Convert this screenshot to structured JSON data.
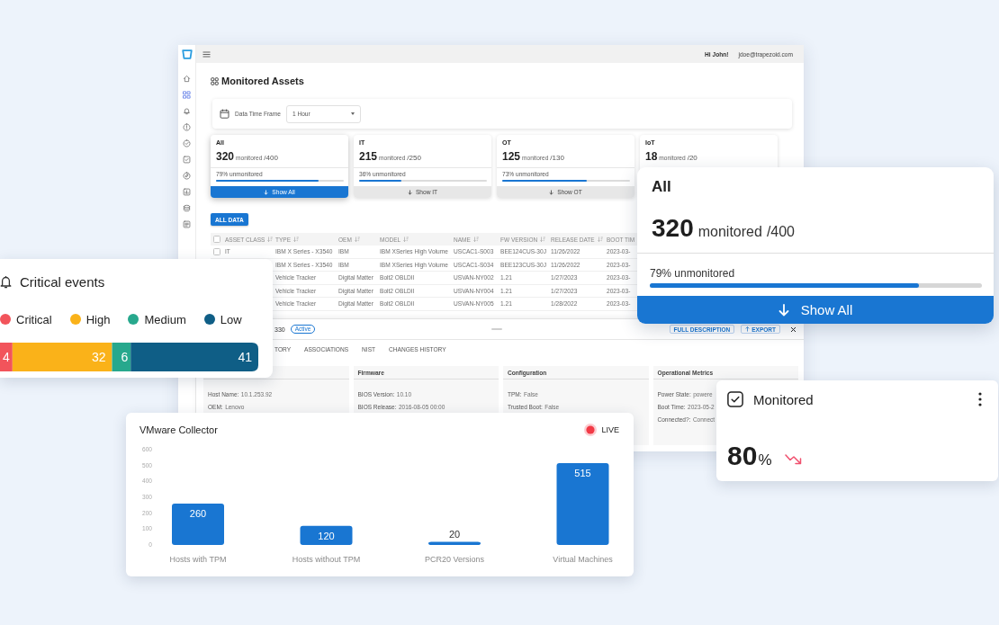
{
  "app": {
    "sidebar": {
      "items": [
        {
          "selected": false
        },
        {
          "selected": true
        },
        {
          "selected": false
        },
        {
          "selected": false
        },
        {
          "selected": false
        },
        {
          "selected": false
        },
        {
          "selected": false
        },
        {
          "selected": false
        },
        {
          "selected": false
        },
        {
          "selected": false
        }
      ]
    },
    "header": {
      "greeting": "Hi John!",
      "email": "jdoe@trapezoid.com"
    },
    "page_title": "Monitored Assets",
    "filter": {
      "label": "Data Time Frame",
      "value": "1 Hour"
    },
    "summary_cards": [
      {
        "title": "All",
        "count": "320",
        "unit": "monitored",
        "total": "/400",
        "unmonitored": "79% unmonitored",
        "level": 0.8,
        "button": "Show All",
        "selected": true
      },
      {
        "title": "IT",
        "count": "215",
        "unit": "monitored",
        "total": "/250",
        "unmonitored": "36% unmonitored",
        "level": 0.33,
        "button": "Show IT",
        "selected": false
      },
      {
        "title": "OT",
        "count": "125",
        "unit": "monitored",
        "total": "/130",
        "unmonitored": "73% unmonitored",
        "level": 0.66,
        "button": "Show OT",
        "selected": false
      },
      {
        "title": "IoT",
        "count": "18",
        "unit": "monitored",
        "total": "/20",
        "selected": false
      }
    ],
    "all_data_button": "ALL DATA",
    "table": {
      "header_checkbox": {
        "checked": false
      },
      "columns": [
        {
          "label": "ASSET CLASS",
          "sortable": true
        },
        {
          "label": "TYPE",
          "sortable": true
        },
        {
          "label": "OEM",
          "sortable": true
        },
        {
          "label": "MODEL",
          "sortable": true
        },
        {
          "label": "NAME",
          "sortable": true
        },
        {
          "label": "FW VERSION",
          "sortable": true
        },
        {
          "label": "RELEASE DATE",
          "sortable": true
        },
        {
          "label": "BOOT TIM",
          "sortable": false
        }
      ],
      "rows": [
        {
          "checked": false,
          "cells": [
            "IT",
            "IBM X Series - X3540",
            "IBM",
            "IBM XSeries High Volume",
            "USCAC1-S003",
            "BEE124CUS-30J",
            "11/26/2022",
            "2023-03-"
          ]
        },
        {
          "cells": [
            "",
            "IBM X Series - X3540",
            "IBM",
            "IBM XSeries High Volume",
            "USCAC1-S034",
            "BEE123CUS-30J",
            "11/26/2022",
            "2023-03-"
          ]
        },
        {
          "cells": [
            "",
            "Vehicle Tracker",
            "Digital Matter",
            "Bolt2 OBLDII",
            "USVAN-NY002",
            "1.21",
            "1/27/2023",
            "2023-03-"
          ]
        },
        {
          "cells": [
            "",
            "Vehicle Tracker",
            "Digital Matter",
            "Bolt2 OBLDII",
            "USVAN-NY004",
            "1.21",
            "1/27/2023",
            "2023-03-"
          ]
        },
        {
          "cells": [
            "",
            "Vehicle Tracker",
            "Digital Matter",
            "Bolt2 OBLDII",
            "USVAN-NY005",
            "1.21",
            "1/28/2022",
            "2023-03-"
          ]
        }
      ]
    },
    "detail": {
      "id": "330",
      "status": "Active",
      "actions": [
        {
          "label": "FULL DESCRIPTION",
          "kind": "plain"
        },
        {
          "label": "EXPORT",
          "kind": "export"
        }
      ],
      "tabs": [
        {
          "label": "TORY",
          "selected": false
        },
        {
          "label": "ASSOCIATIONS",
          "selected": false
        },
        {
          "label": "NIST",
          "selected": false
        },
        {
          "label": "CHANGES HISTORY",
          "selected": false
        }
      ],
      "sections": [
        {
          "rows": [
            {
              "label": "Host Name:",
              "value": "10.1.253.92"
            },
            {
              "label": "OEM:",
              "value": "Lenovo"
            }
          ]
        },
        {
          "title": "Firmware",
          "rows": [
            {
              "label": "BIOS Version:",
              "value": "10.10"
            },
            {
              "label": "BIOS Release:",
              "value": "2016-08-05 00:00"
            }
          ]
        },
        {
          "title": "Configuration",
          "rows": [
            {
              "label": "TPM:",
              "value": "False"
            },
            {
              "label": "Trusted Boot:",
              "value": "False"
            }
          ]
        },
        {
          "title": "Operational Metrics",
          "rows": [
            {
              "label": "Power State:",
              "value": "powere"
            },
            {
              "label": "Boot Time:",
              "value": "2023-05-2"
            },
            {
              "label": "Connected?:",
              "value": "Connect"
            }
          ]
        }
      ]
    }
  },
  "critical_events": {
    "title": "Critical events",
    "chart_data": {
      "type": "bar",
      "orientation": "horizontal",
      "stacked": true,
      "categories": [
        null
      ],
      "series": [
        {
          "name": "Critical",
          "color": "#f2545b",
          "values": [
            4
          ]
        },
        {
          "name": "High",
          "color": "#fab219",
          "values": [
            32
          ]
        },
        {
          "name": "Medium",
          "color": "#27a88d",
          "values": [
            6
          ]
        },
        {
          "name": "Low",
          "color": "#0f5e86",
          "values": [
            41
          ]
        }
      ],
      "data_labels": true
    }
  },
  "all_card": {
    "title": "All",
    "count": "320",
    "unit": "monitored",
    "total": "/400",
    "unmonitored": "79% unmonitored",
    "level": 0.81,
    "button": "Show All",
    "selected": true
  },
  "vmware": {
    "live": "LIVE",
    "chart_data": {
      "type": "bar",
      "title": "VMware Collector",
      "categories": [
        "Hosts with TPM",
        "Hosts without TPM",
        "PCR20 Versions",
        "Virtual Machines"
      ],
      "values": [
        260,
        120,
        20,
        515
      ],
      "ylim": [
        0,
        600
      ],
      "yticks": [
        0,
        100,
        200,
        300,
        400,
        500,
        600
      ],
      "data_labels": true
    }
  },
  "monitored": {
    "title": "Monitored",
    "value": "80",
    "unit": "%"
  }
}
